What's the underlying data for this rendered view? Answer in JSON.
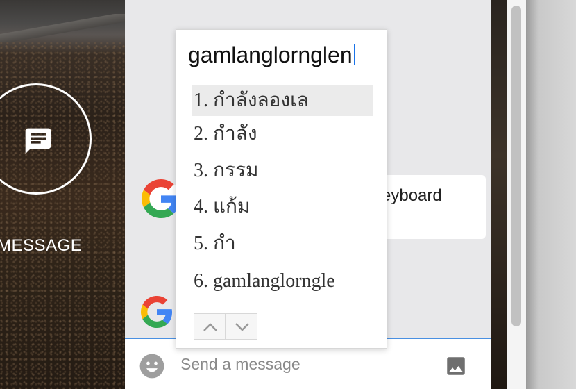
{
  "left_panel": {
    "button_label": "MESSAGE",
    "icon": "chat-bubble-icon"
  },
  "chat": {
    "partial_bubble_text": "eyboard",
    "avatar_icon": "google-g-icon"
  },
  "composer": {
    "placeholder": "Send a message",
    "emoji_icon": "emoji-icon",
    "image_icon": "image-icon",
    "accent": "#4a90e2"
  },
  "ime": {
    "composition": "gamlanglornglen",
    "candidates": [
      {
        "label": "1. กำลังลองเล",
        "selected": true
      },
      {
        "label": "2. กำลัง",
        "selected": false
      },
      {
        "label": "3. กรรม",
        "selected": false
      },
      {
        "label": "4. แก้ม",
        "selected": false
      },
      {
        "label": "5. กำ",
        "selected": false
      },
      {
        "label": "6. gamlanglorngle",
        "selected": false
      }
    ],
    "prev_icon": "chevron-up-icon",
    "next_icon": "chevron-down-icon"
  }
}
